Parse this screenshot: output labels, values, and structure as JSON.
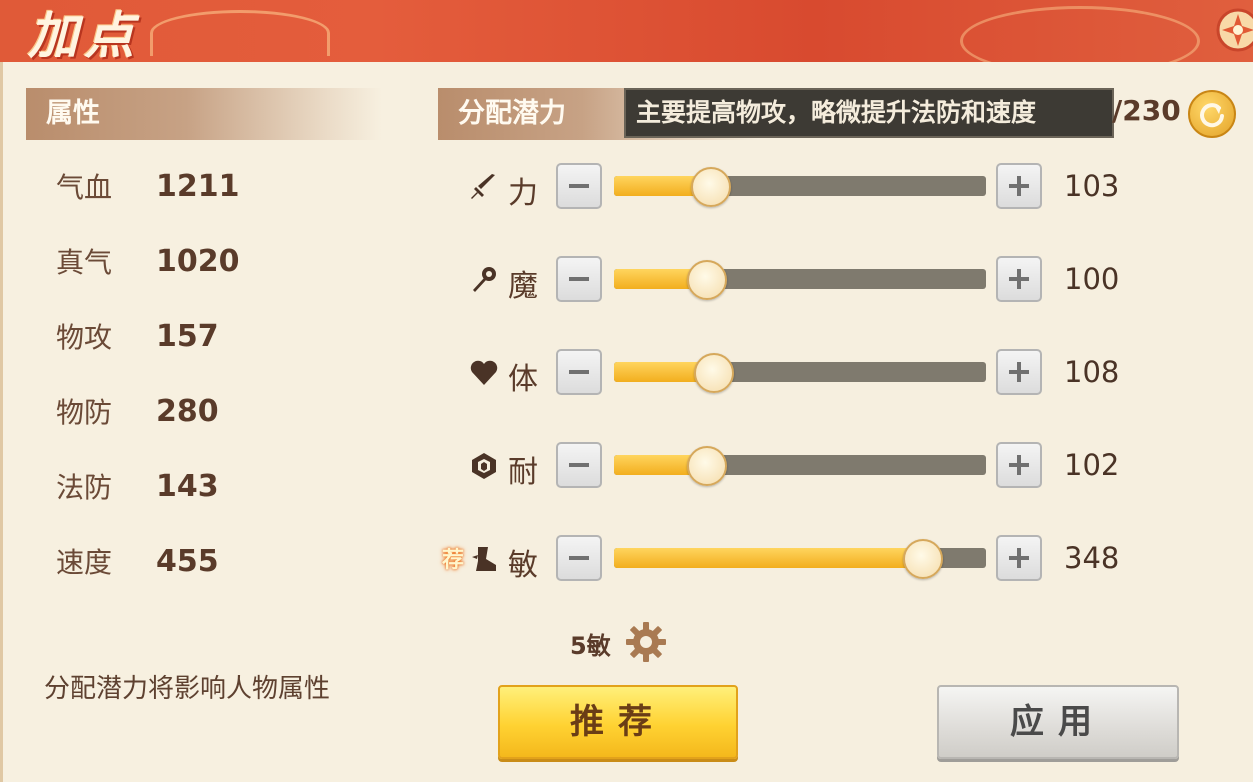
{
  "header": {
    "title": "加点"
  },
  "attributes": {
    "title": "属性",
    "rows": [
      {
        "label": "气血",
        "value": "1211"
      },
      {
        "label": "真气",
        "value": "1020"
      },
      {
        "label": "物攻",
        "value": "157"
      },
      {
        "label": "物防",
        "value": "280"
      },
      {
        "label": "法防",
        "value": "143"
      },
      {
        "label": "速度",
        "value": "455"
      }
    ],
    "note": "分配潜力将影响人物属性"
  },
  "allocate": {
    "title": "分配潜力",
    "tooltip": "主要提高物攻，略微提升法防和速度",
    "remaining": "/230",
    "stats": [
      {
        "label": "力",
        "icon": "sword-icon",
        "value": "103",
        "fill": 0.26
      },
      {
        "label": "魔",
        "icon": "wand-icon",
        "value": "100",
        "fill": 0.25
      },
      {
        "label": "体",
        "icon": "heart-icon",
        "value": "108",
        "fill": 0.27
      },
      {
        "label": "耐",
        "icon": "shield-icon",
        "value": "102",
        "fill": 0.25
      },
      {
        "label": "敏",
        "icon": "boot-icon",
        "value": "348",
        "fill": 0.83,
        "recommended_tag": "荐"
      }
    ],
    "preset": "5敏",
    "recommend_button": "推荐",
    "apply_button": "应用"
  },
  "colors": {
    "header": "#e05a38",
    "fill": "#f2ae1e",
    "track": "#7f7a6e",
    "recommend_button": "#ffd232",
    "apply_button": "#dedcd8"
  }
}
